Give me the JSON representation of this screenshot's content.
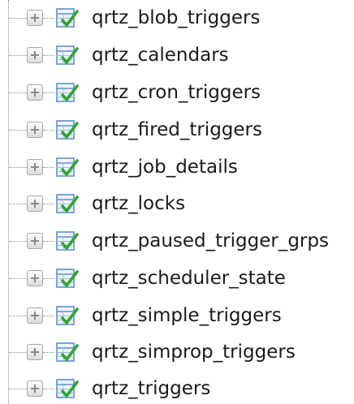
{
  "tree": {
    "items": [
      {
        "label": "qrtz_blob_triggers"
      },
      {
        "label": "qrtz_calendars"
      },
      {
        "label": "qrtz_cron_triggers"
      },
      {
        "label": "qrtz_fired_triggers"
      },
      {
        "label": "qrtz_job_details"
      },
      {
        "label": "qrtz_locks"
      },
      {
        "label": "qrtz_paused_trigger_grps"
      },
      {
        "label": "qrtz_scheduler_state"
      },
      {
        "label": "qrtz_simple_triggers"
      },
      {
        "label": "qrtz_simprop_triggers"
      },
      {
        "label": "qrtz_triggers"
      }
    ],
    "expander_icon": "plus-box-icon",
    "item_icon": "table-icon"
  },
  "colors": {
    "icon_blue": "#5a8fd0",
    "icon_green": "#2fa52f",
    "text": "#1a1a1a",
    "dotted_line": "#8c8c8c"
  }
}
